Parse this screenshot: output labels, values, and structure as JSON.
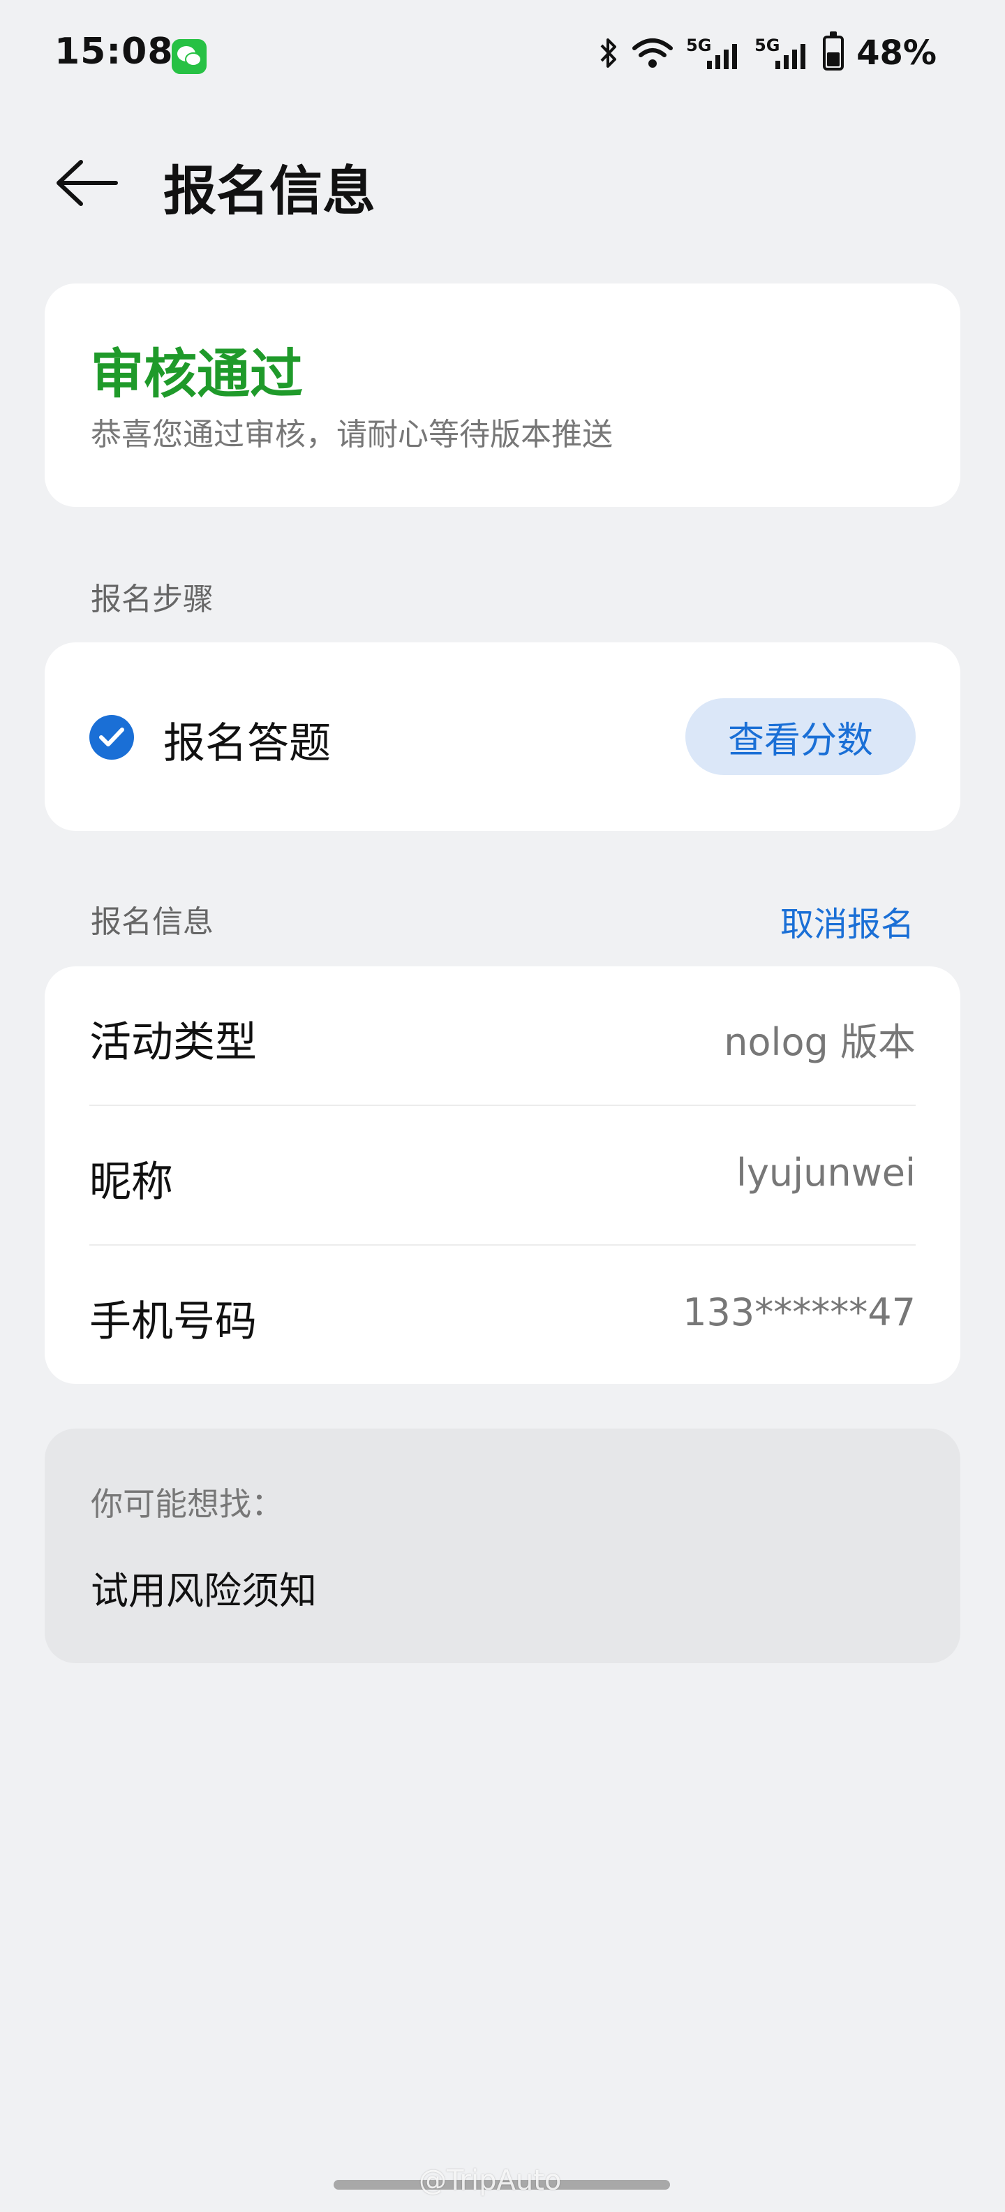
{
  "status_bar": {
    "time": "15:08",
    "battery": "48%",
    "battery_level_percent": 48,
    "net1": "5G",
    "net2": "5G"
  },
  "header": {
    "title": "报名信息"
  },
  "status_card": {
    "title": "审核通过",
    "description": "恭喜您通过审核，请耐心等待版本推送",
    "accent_color": "#1f9a2a"
  },
  "steps": {
    "section_label": "报名步骤",
    "items": [
      {
        "label": "报名答题",
        "action_label": "查看分数",
        "completed": true
      }
    ]
  },
  "info": {
    "section_label": "报名信息",
    "cancel_label": "取消报名",
    "rows": [
      {
        "key": "活动类型",
        "value": "nolog 版本"
      },
      {
        "key": "昵称",
        "value": "lyujunwei"
      },
      {
        "key": "手机号码",
        "value": "133******47"
      }
    ]
  },
  "suggest": {
    "title": "你可能想找：",
    "links": [
      "试用风险须知"
    ]
  },
  "watermark": "@TripAuto",
  "accent_color": "#1a6fd6"
}
